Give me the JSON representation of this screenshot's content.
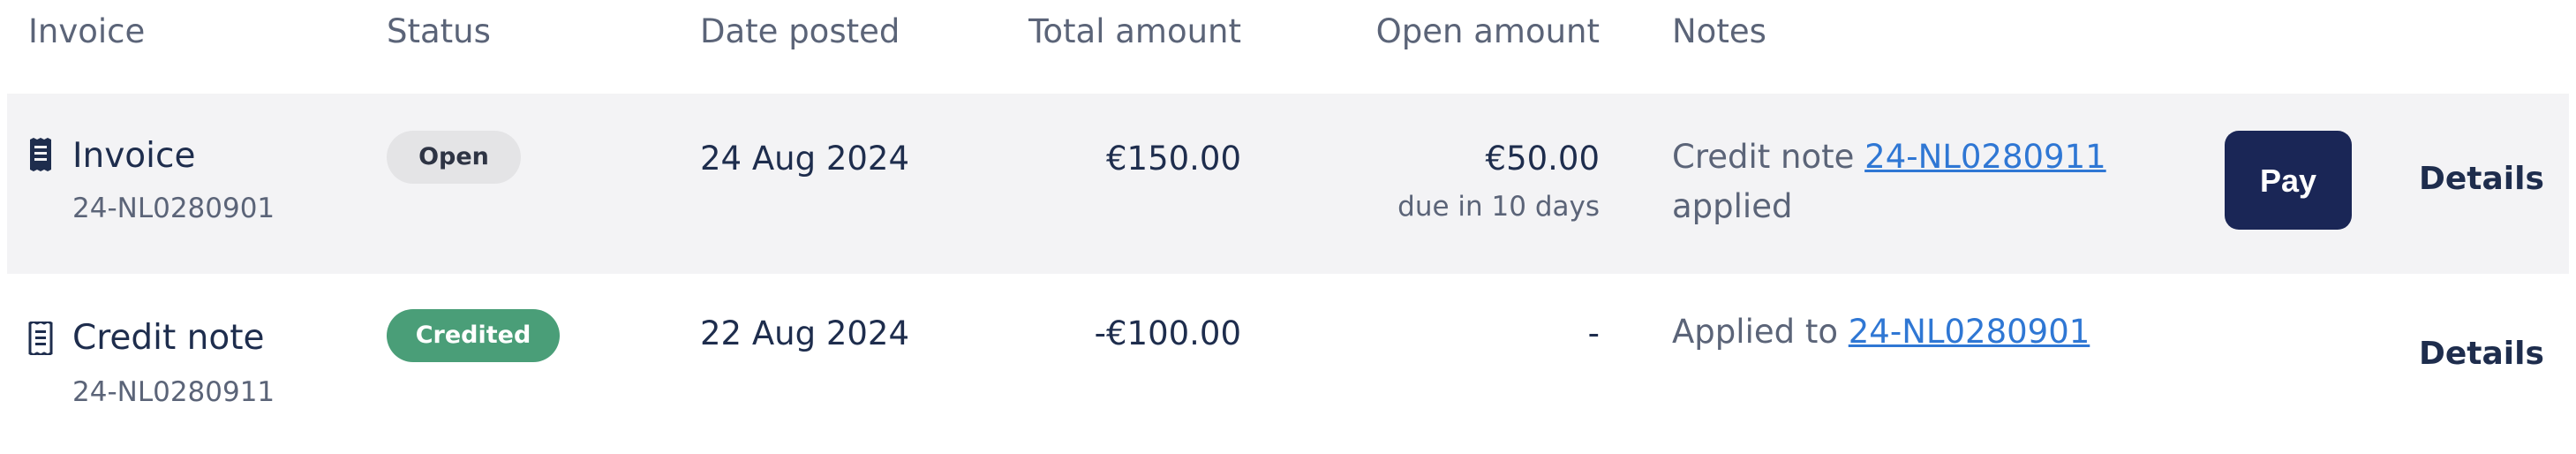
{
  "columns": {
    "invoice": "Invoice",
    "status": "Status",
    "date_posted": "Date posted",
    "total_amount": "Total amount",
    "open_amount": "Open amount",
    "notes": "Notes"
  },
  "rows": [
    {
      "icon": "receipt-icon",
      "type": "Invoice",
      "number": "24-NL0280901",
      "status": "Open",
      "date": "24 Aug 2024",
      "total": "€150.00",
      "open": "€50.00",
      "open_sub": "due in 10 days",
      "note_prefix": "Credit note ",
      "note_link": "24-NL0280911",
      "note_suffix": "applied",
      "pay_label": "Pay",
      "details_label": "Details"
    },
    {
      "icon": "receipt-icon",
      "type": "Credit note",
      "number": "24-NL0280911",
      "status": "Credited",
      "date": "22 Aug 2024",
      "total": "-€100.00",
      "open": "-",
      "note_prefix": "Applied to ",
      "note_link": "24-NL0280901",
      "details_label": "Details"
    }
  ],
  "colors": {
    "row_shade": "#f3f3f5",
    "pay_button": "#1a2656",
    "credited_badge": "#4a9e78",
    "open_badge": "#e4e4e6",
    "link": "#2f77d4"
  }
}
